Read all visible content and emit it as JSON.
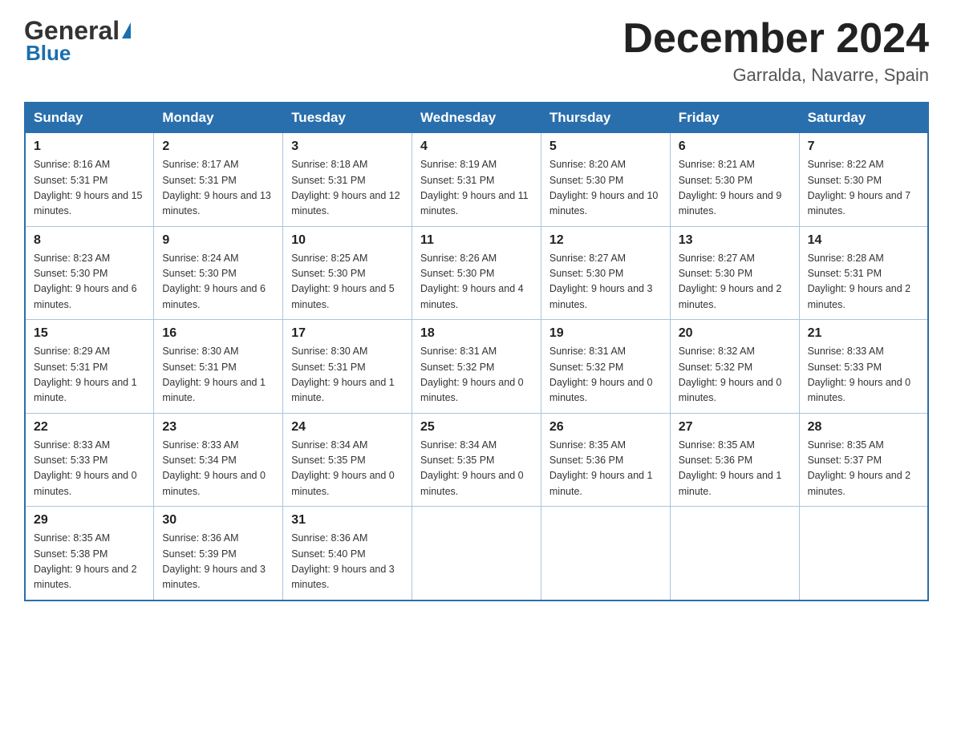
{
  "header": {
    "logo_general": "General",
    "logo_blue": "Blue",
    "month_title": "December 2024",
    "location": "Garralda, Navarre, Spain"
  },
  "days_of_week": [
    "Sunday",
    "Monday",
    "Tuesday",
    "Wednesday",
    "Thursday",
    "Friday",
    "Saturday"
  ],
  "weeks": [
    [
      {
        "day": "1",
        "sunrise": "8:16 AM",
        "sunset": "5:31 PM",
        "daylight": "9 hours and 15 minutes."
      },
      {
        "day": "2",
        "sunrise": "8:17 AM",
        "sunset": "5:31 PM",
        "daylight": "9 hours and 13 minutes."
      },
      {
        "day": "3",
        "sunrise": "8:18 AM",
        "sunset": "5:31 PM",
        "daylight": "9 hours and 12 minutes."
      },
      {
        "day": "4",
        "sunrise": "8:19 AM",
        "sunset": "5:31 PM",
        "daylight": "9 hours and 11 minutes."
      },
      {
        "day": "5",
        "sunrise": "8:20 AM",
        "sunset": "5:30 PM",
        "daylight": "9 hours and 10 minutes."
      },
      {
        "day": "6",
        "sunrise": "8:21 AM",
        "sunset": "5:30 PM",
        "daylight": "9 hours and 9 minutes."
      },
      {
        "day": "7",
        "sunrise": "8:22 AM",
        "sunset": "5:30 PM",
        "daylight": "9 hours and 7 minutes."
      }
    ],
    [
      {
        "day": "8",
        "sunrise": "8:23 AM",
        "sunset": "5:30 PM",
        "daylight": "9 hours and 6 minutes."
      },
      {
        "day": "9",
        "sunrise": "8:24 AM",
        "sunset": "5:30 PM",
        "daylight": "9 hours and 6 minutes."
      },
      {
        "day": "10",
        "sunrise": "8:25 AM",
        "sunset": "5:30 PM",
        "daylight": "9 hours and 5 minutes."
      },
      {
        "day": "11",
        "sunrise": "8:26 AM",
        "sunset": "5:30 PM",
        "daylight": "9 hours and 4 minutes."
      },
      {
        "day": "12",
        "sunrise": "8:27 AM",
        "sunset": "5:30 PM",
        "daylight": "9 hours and 3 minutes."
      },
      {
        "day": "13",
        "sunrise": "8:27 AM",
        "sunset": "5:30 PM",
        "daylight": "9 hours and 2 minutes."
      },
      {
        "day": "14",
        "sunrise": "8:28 AM",
        "sunset": "5:31 PM",
        "daylight": "9 hours and 2 minutes."
      }
    ],
    [
      {
        "day": "15",
        "sunrise": "8:29 AM",
        "sunset": "5:31 PM",
        "daylight": "9 hours and 1 minute."
      },
      {
        "day": "16",
        "sunrise": "8:30 AM",
        "sunset": "5:31 PM",
        "daylight": "9 hours and 1 minute."
      },
      {
        "day": "17",
        "sunrise": "8:30 AM",
        "sunset": "5:31 PM",
        "daylight": "9 hours and 1 minute."
      },
      {
        "day": "18",
        "sunrise": "8:31 AM",
        "sunset": "5:32 PM",
        "daylight": "9 hours and 0 minutes."
      },
      {
        "day": "19",
        "sunrise": "8:31 AM",
        "sunset": "5:32 PM",
        "daylight": "9 hours and 0 minutes."
      },
      {
        "day": "20",
        "sunrise": "8:32 AM",
        "sunset": "5:32 PM",
        "daylight": "9 hours and 0 minutes."
      },
      {
        "day": "21",
        "sunrise": "8:33 AM",
        "sunset": "5:33 PM",
        "daylight": "9 hours and 0 minutes."
      }
    ],
    [
      {
        "day": "22",
        "sunrise": "8:33 AM",
        "sunset": "5:33 PM",
        "daylight": "9 hours and 0 minutes."
      },
      {
        "day": "23",
        "sunrise": "8:33 AM",
        "sunset": "5:34 PM",
        "daylight": "9 hours and 0 minutes."
      },
      {
        "day": "24",
        "sunrise": "8:34 AM",
        "sunset": "5:35 PM",
        "daylight": "9 hours and 0 minutes."
      },
      {
        "day": "25",
        "sunrise": "8:34 AM",
        "sunset": "5:35 PM",
        "daylight": "9 hours and 0 minutes."
      },
      {
        "day": "26",
        "sunrise": "8:35 AM",
        "sunset": "5:36 PM",
        "daylight": "9 hours and 1 minute."
      },
      {
        "day": "27",
        "sunrise": "8:35 AM",
        "sunset": "5:36 PM",
        "daylight": "9 hours and 1 minute."
      },
      {
        "day": "28",
        "sunrise": "8:35 AM",
        "sunset": "5:37 PM",
        "daylight": "9 hours and 2 minutes."
      }
    ],
    [
      {
        "day": "29",
        "sunrise": "8:35 AM",
        "sunset": "5:38 PM",
        "daylight": "9 hours and 2 minutes."
      },
      {
        "day": "30",
        "sunrise": "8:36 AM",
        "sunset": "5:39 PM",
        "daylight": "9 hours and 3 minutes."
      },
      {
        "day": "31",
        "sunrise": "8:36 AM",
        "sunset": "5:40 PM",
        "daylight": "9 hours and 3 minutes."
      },
      null,
      null,
      null,
      null
    ]
  ]
}
